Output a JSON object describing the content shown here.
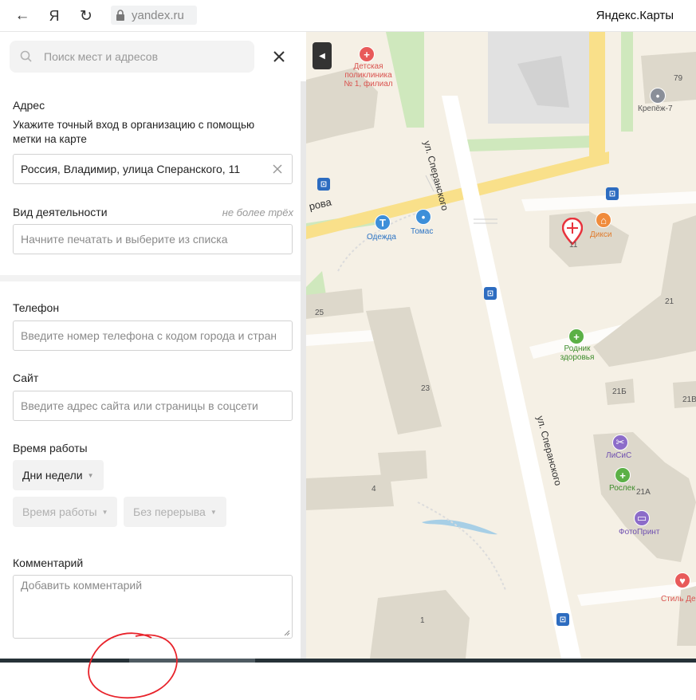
{
  "browser": {
    "back_icon": "←",
    "yandex_icon": "Я",
    "reload_icon": "↻",
    "url": "yandex.ru",
    "title": "Яндекс.Карты"
  },
  "search": {
    "placeholder": "Поиск мест и адресов"
  },
  "form": {
    "address_label": "Адрес",
    "address_hint": "Укажите точный вход в организацию с помощью метки на карте",
    "address_value": "Россия, Владимир, улица Сперанского, 11",
    "activity_label": "Вид деятельности",
    "activity_note": "не более трёх",
    "activity_placeholder": "Начните печатать и выберите из списка",
    "phone_label": "Телефон",
    "phone_placeholder": "Введите номер телефона с кодом города и страны",
    "site_label": "Сайт",
    "site_placeholder": "Введите адрес сайта или страницы в соцсети",
    "hours_label": "Время работы",
    "days_select": "Дни недели",
    "hours_select": "Время работы",
    "break_select": "Без перерыва",
    "comment_label": "Комментарий",
    "comment_placeholder": "Добавить комментарий"
  },
  "map": {
    "streets": {
      "speransky_top": "ул. Сперанского",
      "speransky_bottom": "ул. Сперанского",
      "other": "рова"
    },
    "pois": {
      "clinic": "Детская поликлиника № 1, филиал",
      "odezhda": "Одежда",
      "tomas": "Томас",
      "diksi": "Дикси",
      "krepezh": "Крепёж-7",
      "rodnik": "Родник здоровья",
      "lisis": "ЛиСиС",
      "roslek": "Рослек",
      "fotoprint": "ФотоПринт",
      "stil": "Стиль Де"
    },
    "houses": {
      "h79": "79",
      "h11": "11",
      "h21": "21",
      "h25": "25",
      "h23": "23",
      "h21b": "21Б",
      "h21c": "21В",
      "h21a": "21А",
      "h4": "4",
      "h1": "1"
    },
    "bus_symbol": "⊡"
  }
}
